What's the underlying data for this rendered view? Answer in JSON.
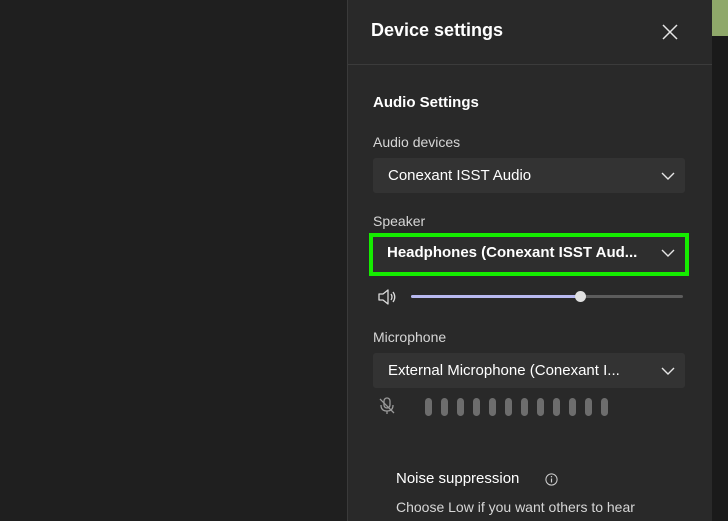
{
  "panel": {
    "title": "Device settings",
    "section_title": "Audio Settings"
  },
  "audio_devices": {
    "label": "Audio devices",
    "selected": "Conexant ISST Audio"
  },
  "speaker": {
    "label": "Speaker",
    "selected": "Headphones (Conexant ISST Aud...",
    "highlight_color": "#15ec00",
    "volume_fraction": 0.62
  },
  "microphone": {
    "label": "Microphone",
    "selected": "External Microphone (Conexant I...",
    "level_bar_count": 12
  },
  "noise_suppression": {
    "title": "Noise suppression",
    "description": "Choose Low if you want others to hear"
  },
  "icons": {
    "close": "close-icon",
    "chevron": "chevron-down-icon",
    "speaker": "speaker-icon",
    "mic_muted": "mic-muted-icon",
    "info": "info-icon"
  },
  "colors": {
    "panel_bg": "#292929",
    "select_bg": "#333333",
    "slider_fill": "#b8b9f0",
    "accent_green_strip": "#8fa86a"
  }
}
